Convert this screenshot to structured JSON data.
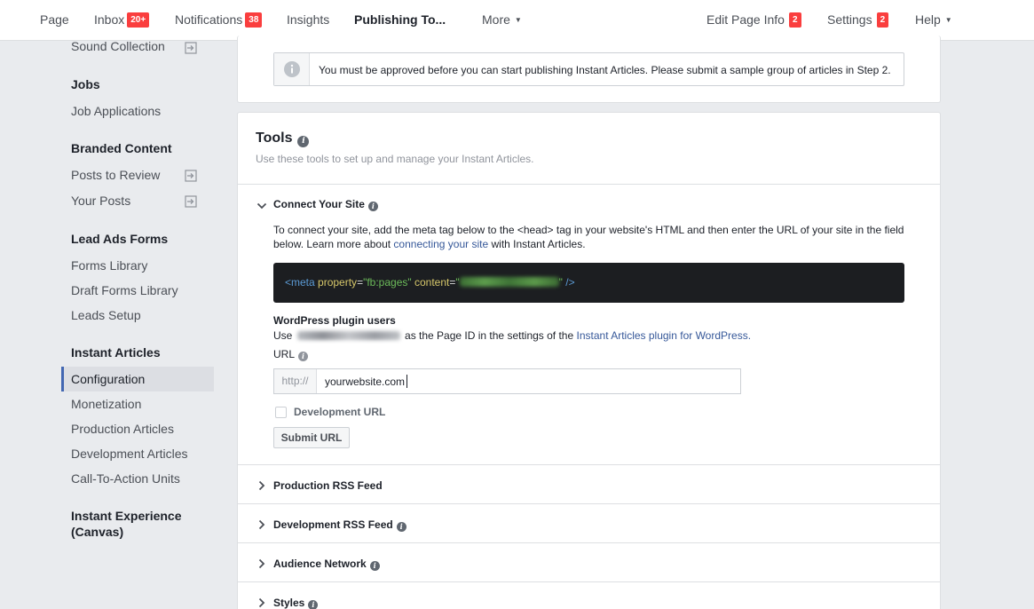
{
  "topnav": {
    "items": [
      {
        "label": "Page"
      },
      {
        "label": "Inbox",
        "badge": "20+"
      },
      {
        "label": "Notifications",
        "badge": "38"
      },
      {
        "label": "Insights"
      },
      {
        "label": "Publishing To..."
      },
      {
        "label": "More"
      }
    ],
    "right": [
      {
        "label": "Edit Page Info",
        "badge": "2"
      },
      {
        "label": "Settings",
        "badge": "2"
      },
      {
        "label": "Help"
      }
    ]
  },
  "sidebar": {
    "top_item": "Sound Collection",
    "groups": [
      {
        "heading": "Jobs",
        "items": [
          "Job Applications"
        ]
      },
      {
        "heading": "Branded Content",
        "items": [
          "Posts to Review",
          "Your Posts"
        ]
      },
      {
        "heading": "Lead Ads Forms",
        "items": [
          "Forms Library",
          "Draft Forms Library",
          "Leads Setup"
        ]
      },
      {
        "heading": "Instant Articles",
        "items": [
          "Configuration",
          "Monetization",
          "Production Articles",
          "Development Articles",
          "Call-To-Action Units"
        ]
      },
      {
        "heading_line1": "Instant Experience",
        "heading_line2": "(Canvas)"
      }
    ],
    "active_item": "Configuration"
  },
  "notice": {
    "text": "You must be approved before you can start publishing Instant Articles. Please submit a sample group of articles in Step 2."
  },
  "tools": {
    "title": "Tools",
    "subtitle": "Use these tools to set up and manage your Instant Articles.",
    "connect": {
      "title": "Connect Your Site",
      "desc_before": "To connect your site, add the meta tag below to the <head> tag in your website's HTML and then enter the URL of your site in the field below. Learn more about ",
      "desc_link": "connecting your site",
      "desc_after": " with Instant Articles.",
      "code": {
        "tag_open": "<meta",
        "attr1": "property",
        "val1": "\"fb:pages\"",
        "attr2": "content",
        "quote_open": "\"",
        "quote_close": "\"",
        "tag_close": "/>"
      },
      "wp_title": "WordPress plugin users",
      "wp_before": "Use",
      "wp_after": "as the Page ID in the settings of the",
      "wp_link": "Instant Articles plugin for WordPress.",
      "url_label": "URL",
      "url_prefix": "http://",
      "url_value": "yourwebsite.com",
      "dev_url_label": "Development URL",
      "submit_label": "Submit URL"
    },
    "sections": [
      {
        "title": "Production RSS Feed",
        "info": false
      },
      {
        "title": "Development RSS Feed",
        "info": true
      },
      {
        "title": "Audience Network",
        "info": true
      },
      {
        "title": "Styles",
        "info": true
      }
    ]
  },
  "colors": {
    "accent": "#4267b2",
    "badge": "#fa3e3e",
    "link": "#365899",
    "code_bg": "#1c1e21"
  },
  "icons": {
    "notice": "info-icon",
    "external": "external-link-icon",
    "expand": "chevron-down-icon",
    "collapse": "chevron-right-icon"
  }
}
